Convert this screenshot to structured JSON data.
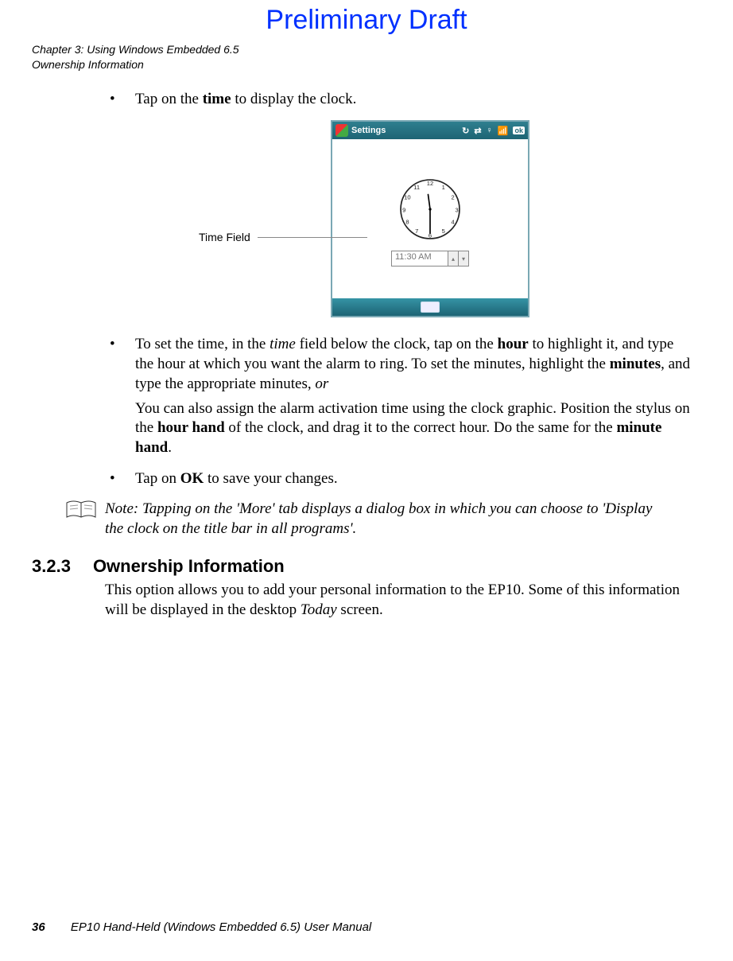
{
  "draft_label": "Preliminary Draft",
  "running_head": {
    "line1": "Chapter 3:  Using Windows Embedded 6.5",
    "line2": "Ownership Information"
  },
  "bullet1": {
    "pre": "Tap on the ",
    "bold": "time",
    "post": " to display the clock."
  },
  "figure": {
    "callout": "Time Field",
    "titlebar_label": "Settings",
    "ok_label": "ok",
    "time_value": "11:30 AM",
    "clock_numbers": [
      "12",
      "1",
      "2",
      "3",
      "4",
      "5",
      "6",
      "7",
      "8",
      "9",
      "10",
      "11"
    ],
    "status_icons": [
      "↻",
      "⇄",
      "♀",
      "📶"
    ]
  },
  "bullet2": {
    "t1": "To set the time, in the ",
    "i1": "time",
    "t2": " field below the clock, tap on the ",
    "b1": "hour",
    "t3": " to highlight it, and type the hour at which you want the alarm to ring. To set the minutes, highlight the ",
    "b2": "min­utes",
    "t4": ", and type the appropriate minutes, ",
    "i2": "or"
  },
  "bullet2_para": {
    "t1": "You can also assign the alarm activation time using the clock graphic. Position the stylus on the ",
    "b1": "hour hand",
    "t2": " of the clock, and drag it to the correct hour. Do the same for the ",
    "b2": "minute hand",
    "t3": "."
  },
  "bullet3": {
    "t1": "Tap on ",
    "b1": "OK",
    "t2": " to save your changes."
  },
  "note": {
    "label": "Note:",
    "text": " Tapping on the 'More' tab displays a dialog box in which you can choose to 'Dis­play the clock on the title bar in all programs'."
  },
  "section": {
    "num": "3.2.3",
    "title": "Ownership Information",
    "body_t1": "This option allows you to add your personal information to the EP10. Some of this informa­tion will be displayed in the desktop ",
    "body_i1": "Today",
    "body_t2": " screen."
  },
  "footer": {
    "page": "36",
    "title": "EP10 Hand-Held (Windows Embedded 6.5) User Manual"
  }
}
